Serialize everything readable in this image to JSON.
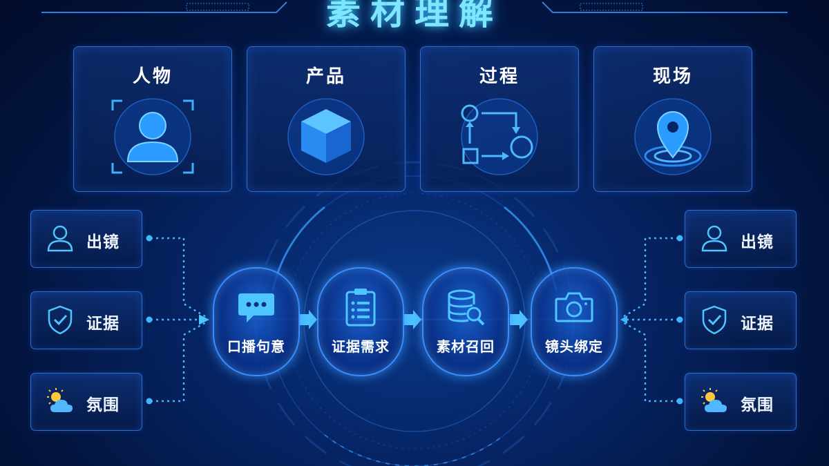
{
  "title": "素材理解",
  "categories": [
    {
      "label": "人物",
      "icon": "person-scan-icon"
    },
    {
      "label": "产品",
      "icon": "cube-icon"
    },
    {
      "label": "过程",
      "icon": "process-flow-icon"
    },
    {
      "label": "现场",
      "icon": "location-pin-icon"
    }
  ],
  "left_inputs": [
    {
      "label": "出镜",
      "icon": "person-icon"
    },
    {
      "label": "证据",
      "icon": "shield-check-icon"
    },
    {
      "label": "氛围",
      "icon": "sun-cloud-icon"
    }
  ],
  "right_outputs": [
    {
      "label": "出镜",
      "icon": "person-icon"
    },
    {
      "label": "证据",
      "icon": "shield-check-icon"
    },
    {
      "label": "氛围",
      "icon": "sun-cloud-icon"
    }
  ],
  "pipeline": [
    {
      "label": "口播句意",
      "icon": "chat-bubble-icon"
    },
    {
      "label": "证据需求",
      "icon": "clipboard-list-icon"
    },
    {
      "label": "素材召回",
      "icon": "database-search-icon"
    },
    {
      "label": "镜头绑定",
      "icon": "camera-icon"
    }
  ],
  "colors": {
    "accent": "#3fb8ff",
    "border": "#2f6fc8",
    "title_glow": "#7fe6ff",
    "background": "#03153f"
  }
}
